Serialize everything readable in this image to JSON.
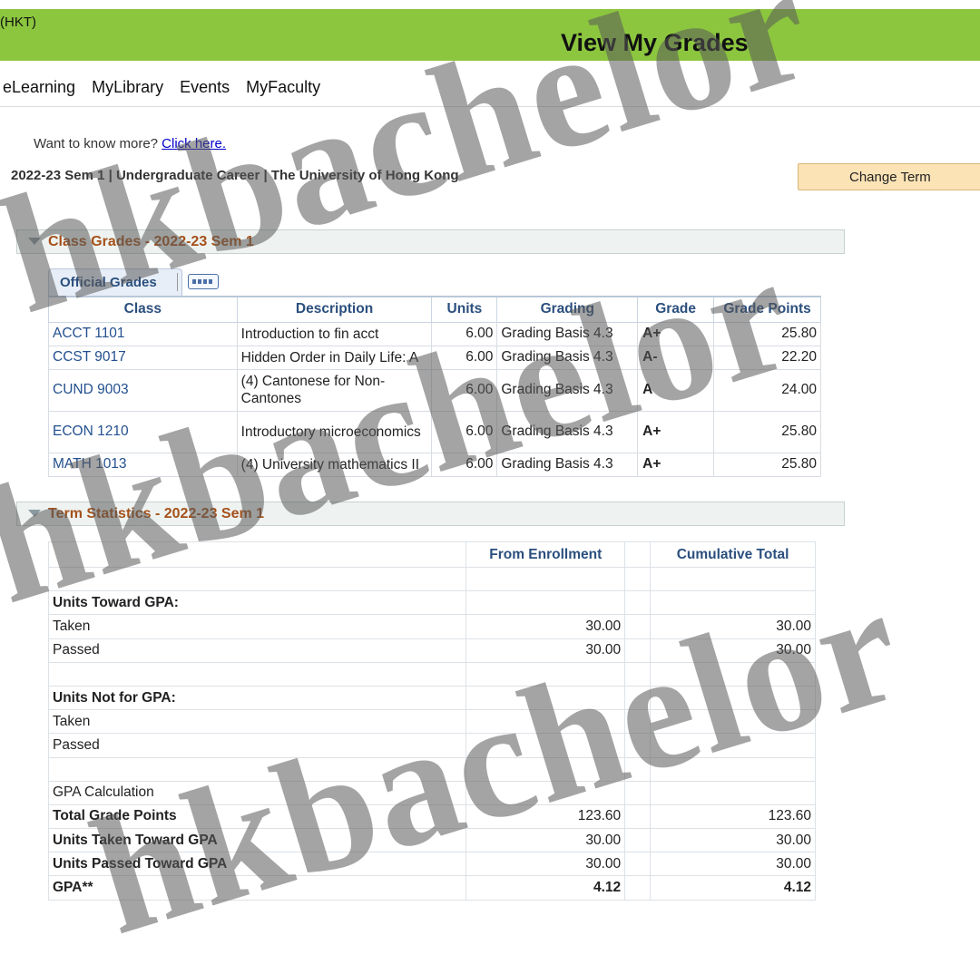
{
  "header": {
    "timezone": "(HKT)",
    "title": "View My Grades"
  },
  "nav": {
    "items": [
      "eLearning",
      "MyLibrary",
      "Events",
      "MyFaculty"
    ]
  },
  "info": {
    "want_more_text": "Want to know more?",
    "click_here": "Click here.",
    "career_line": "2022-23 Sem 1 | Undergraduate Career | The University of Hong Kong",
    "change_term": "Change Term"
  },
  "class_grades": {
    "section_title": "Class Grades - 2022-23 Sem 1",
    "tab_label": "Official Grades",
    "columns": [
      "Class",
      "Description",
      "Units",
      "Grading",
      "Grade",
      "Grade Points"
    ],
    "rows": [
      {
        "class": "ACCT 1101",
        "description": "Introduction to fin acct",
        "units": "6.00",
        "grading": "Grading Basis 4.3",
        "grade": "A+",
        "points": "25.80"
      },
      {
        "class": "CCST 9017",
        "description": "Hidden Order in Daily Life: A",
        "units": "6.00",
        "grading": "Grading Basis 4.3",
        "grade": "A-",
        "points": "22.20"
      },
      {
        "class": "CUND 9003",
        "description": "(4) Cantonese for Non-Cantones",
        "units": "6.00",
        "grading": "Grading Basis 4.3",
        "grade": "A",
        "points": "24.00"
      },
      {
        "class": "ECON 1210",
        "description": "Introductory microeconomics",
        "units": "6.00",
        "grading": "Grading Basis 4.3",
        "grade": "A+",
        "points": "25.80"
      },
      {
        "class": "MATH 1013",
        "description": "(4) University mathematics II",
        "units": "6.00",
        "grading": "Grading Basis 4.3",
        "grade": "A+",
        "points": "25.80"
      }
    ]
  },
  "term_stats": {
    "section_title": "Term Statistics - 2022-23 Sem 1",
    "columns": [
      "From Enrollment",
      "Cumulative Total"
    ],
    "units_toward_gpa": "Units Toward GPA:",
    "taken": "Taken",
    "passed": "Passed",
    "taken_enroll": "30.00",
    "taken_cum": "30.00",
    "passed_enroll": "30.00",
    "passed_cum": "30.00",
    "units_not_for_gpa": "Units Not for GPA:",
    "taken2": "Taken",
    "passed2": "Passed",
    "gpa_calc": "GPA Calculation",
    "total_grade_points": "Total Grade Points",
    "tgp_enroll": "123.60",
    "tgp_cum": "123.60",
    "units_taken_toward": "Units Taken Toward GPA",
    "utt_enroll": "30.00",
    "utt_cum": "30.00",
    "units_passed_toward": "Units Passed Toward GPA",
    "upt_enroll": "30.00",
    "upt_cum": "30.00",
    "gpa_label": "GPA**",
    "gpa_enroll": "4.12",
    "gpa_cum": "4.12"
  },
  "watermark": {
    "text": "hkbachelor"
  }
}
